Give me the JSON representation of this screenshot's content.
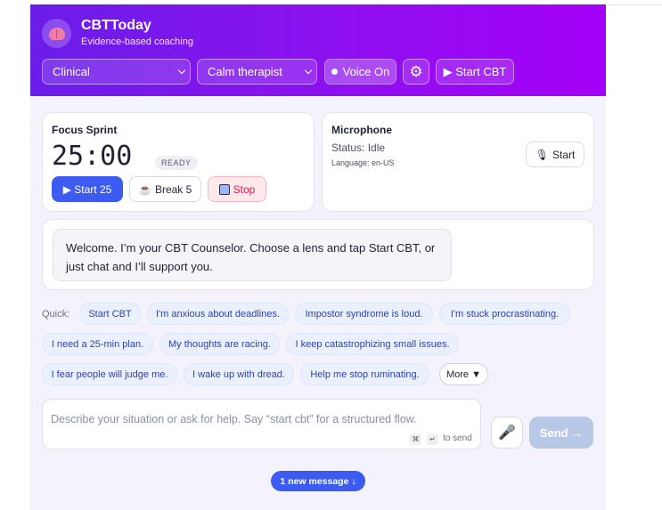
{
  "header": {
    "title": "CBTToday",
    "subtitle": "Evidence-based coaching",
    "lens_select": "Clinical",
    "persona_select": "Calm therapist",
    "voice_button": "Voice On",
    "settings_icon": "gear-icon",
    "start_cbt_button": "▶ Start CBT"
  },
  "focus_sprint": {
    "title": "Focus Sprint",
    "timer": "25:00",
    "status_badge": "READY",
    "start_button": "▶ Start 25",
    "break_button": "☕ Break 5",
    "stop_button": "Stop"
  },
  "microphone": {
    "title": "Microphone",
    "status": "Status: Idle",
    "language": "Language: en-US",
    "start_button": "Start"
  },
  "chat": {
    "welcome": "Welcome. I’m your CBT Counselor. Choose a lens and tap Start CBT, or just chat and I’ll support you."
  },
  "quick": {
    "label": "Quick:",
    "chips": [
      "Start CBT",
      "I'm anxious about deadlines.",
      "Impostor syndrome is loud.",
      "I'm stuck procrastinating.",
      "I need a 25-min plan.",
      "My thoughts are racing.",
      "I keep catastrophizing small issues.",
      "I fear people will judge me.",
      "I wake up with dread.",
      "Help me stop ruminating."
    ],
    "more": "More ▼"
  },
  "composer": {
    "placeholder": "Describe your situation or ask for help. Say “start cbt” for a structured flow.",
    "key1": "⌘",
    "key2": "↵",
    "hint": "to send",
    "send_button": "Send →"
  },
  "new_message_pill": "1 new message ↓",
  "colors": {
    "header_gradient_start": "#6a1de9",
    "header_gradient_end": "#a400f7",
    "primary": "#3c5bf0",
    "chip_bg": "#eaf1fd",
    "stop_red": "#d81b4a"
  }
}
